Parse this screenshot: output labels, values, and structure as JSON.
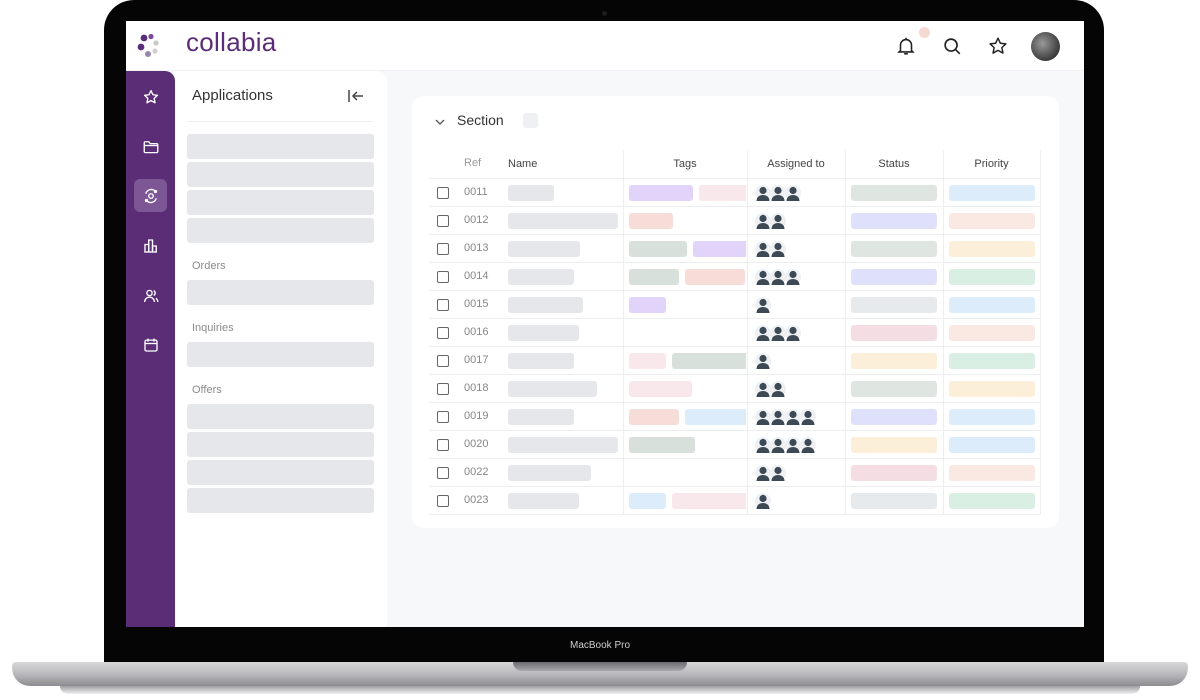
{
  "device": {
    "label": "MacBook Pro"
  },
  "app": {
    "brand": "collabia",
    "colors": {
      "brand": "#5b2d78",
      "rail": "#5a2d76",
      "rail_active": "#7d5695",
      "placeholder": "#e6e7ea"
    },
    "topbar": {
      "icons": [
        "bell-icon",
        "search-icon",
        "star-icon",
        "user-avatar"
      ],
      "notification_dot": true
    },
    "rail": {
      "items": [
        {
          "icon": "star-icon",
          "active": false
        },
        {
          "icon": "folder-icon",
          "active": false
        },
        {
          "icon": "orbit-icon",
          "active": true
        },
        {
          "icon": "bar-chart-icon",
          "active": false
        },
        {
          "icon": "users-icon",
          "active": false
        },
        {
          "icon": "calendar-icon",
          "active": false
        }
      ]
    },
    "panel": {
      "title": "Applications",
      "collapse_icon": "collapse-left-icon",
      "groups": [
        {
          "label": "",
          "items": 4
        },
        {
          "label": "Orders",
          "items": 1
        },
        {
          "label": "Inquiries",
          "items": 1
        },
        {
          "label": "Offers",
          "items": 4
        }
      ]
    },
    "section": {
      "title": "Section",
      "expanded": true,
      "columns": [
        "Ref",
        "Name",
        "Tags",
        "Assigned to",
        "Status",
        "Priority"
      ],
      "rows": [
        {
          "ref": "0011",
          "assignees": 3,
          "tags": [
            "purple",
            "pink"
          ],
          "status": "gray-green",
          "priority": "blue"
        },
        {
          "ref": "0012",
          "assignees": 2,
          "tags": [
            "salmon"
          ],
          "status": "lavender",
          "priority": "peach"
        },
        {
          "ref": "0013",
          "assignees": 2,
          "tags": [
            "sage",
            "purple"
          ],
          "status": "gray-green",
          "priority": "cream"
        },
        {
          "ref": "0014",
          "assignees": 3,
          "tags": [
            "sage",
            "salmon"
          ],
          "status": "lavender",
          "priority": "mint"
        },
        {
          "ref": "0015",
          "assignees": 1,
          "tags": [
            "purple"
          ],
          "status": "light-gray",
          "priority": "blue"
        },
        {
          "ref": "0016",
          "assignees": 3,
          "tags": [],
          "status": "rose",
          "priority": "peach"
        },
        {
          "ref": "0017",
          "assignees": 1,
          "tags": [
            "pink",
            "sage"
          ],
          "status": "cream",
          "priority": "mint"
        },
        {
          "ref": "0018",
          "assignees": 2,
          "tags": [
            "pink"
          ],
          "status": "gray-green",
          "priority": "cream"
        },
        {
          "ref": "0019",
          "assignees": 4,
          "tags": [
            "salmon",
            "blue"
          ],
          "status": "lavender",
          "priority": "blue"
        },
        {
          "ref": "0020",
          "assignees": 4,
          "tags": [
            "sage"
          ],
          "status": "cream",
          "priority": "blue"
        },
        {
          "ref": "0022",
          "assignees": 2,
          "tags": [],
          "status": "rose",
          "priority": "peach"
        },
        {
          "ref": "0023",
          "assignees": 1,
          "tags": [
            "blue",
            "pink"
          ],
          "status": "light-gray",
          "priority": "mint"
        }
      ],
      "swatches": {
        "purple": "#e1d3fa",
        "pink": "#f8e8ec",
        "salmon": "#f6ddd7",
        "sage": "#d8e0dc",
        "blue": "#dcecfb",
        "gray-green": "#dfe6e2",
        "lavender": "#dfe1fb",
        "peach": "#fae9e2",
        "cream": "#fcefd9",
        "mint": "#d9efe4",
        "light-gray": "#e7eaec",
        "rose": "#f5dde4"
      }
    }
  }
}
